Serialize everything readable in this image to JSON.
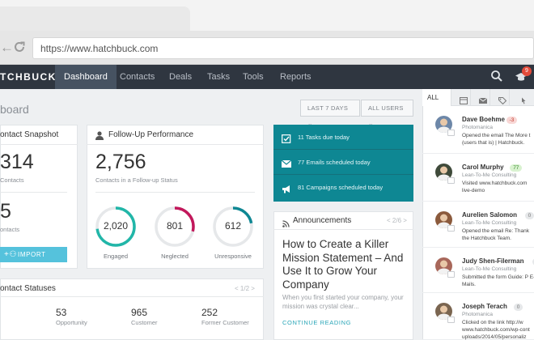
{
  "browser": {
    "url": "https://www.hatchbuck.com",
    "back_icon": "back-arrow-icon",
    "reload_icon": "reload-icon"
  },
  "app": {
    "logo": "TCHBUCK",
    "nav": [
      {
        "label": "Dashboard",
        "active": true
      },
      {
        "label": "Contacts",
        "active": false
      },
      {
        "label": "Deals",
        "active": false
      },
      {
        "label": "Tasks",
        "active": false
      },
      {
        "label": "Tools",
        "active": false
      },
      {
        "label": "Reports",
        "active": false
      }
    ],
    "notification_count": "9"
  },
  "page": {
    "title": "board",
    "filters": {
      "date": "LAST 7 DAYS ⌄",
      "users": "ALL USERS ⌄"
    }
  },
  "contact_snapshot": {
    "title": "ontact Snapshot",
    "total_value": "314",
    "total_label": "Contacts",
    "second_value": "5",
    "second_label": "ontacts",
    "import_label": "IMPORT"
  },
  "follow_up": {
    "title": "Follow-Up Performance",
    "total": "2,756",
    "subtitle": "Contacts in a Follow-up Status",
    "rings": [
      {
        "value": "2,020",
        "label": "Engaged",
        "color": "#21b6a8",
        "fraction": 0.73
      },
      {
        "value": "801",
        "label": "Neglected",
        "color": "#c2185b",
        "fraction": 0.29
      },
      {
        "value": "612",
        "label": "Unresponsive",
        "color": "#0e8793",
        "fraction": 0.22
      }
    ]
  },
  "teal_panel": {
    "rows": [
      {
        "icon": "checkbox-icon",
        "label": "11 Tasks due today"
      },
      {
        "icon": "envelope-icon",
        "label": "77 Emails scheduled today"
      },
      {
        "icon": "megaphone-icon",
        "label": "81 Campaigns scheduled today"
      }
    ]
  },
  "announcements": {
    "title": "Announcements",
    "pager": "< 2/6 >",
    "headline": "How to Create a Killer Mission Statement – And Use It to Grow Your Company",
    "blurb": "When you first started your company, your mission was crystal clear...",
    "link": "CONTINUE READING"
  },
  "contact_statuses": {
    "title": "ontact Statuses",
    "pager": "< 1/2 >",
    "stats": [
      {
        "value": "53",
        "label": "Opportunity"
      },
      {
        "value": "965",
        "label": "Customer"
      },
      {
        "value": "252",
        "label": "Former Customer"
      }
    ]
  },
  "activity": {
    "tab_all": "ALL",
    "tab_icons": [
      "card-icon",
      "envelope-icon",
      "tag-icon",
      "pointer-icon"
    ],
    "items": [
      {
        "name": "Dave Boehme",
        "score": "-3",
        "score_bg": "#f8d7d5",
        "score_fg": "#c0392b",
        "company": "Photomanica",
        "desc": "Opened the email The More t (users that is) | Hatchbuck.",
        "avatar_bg": "#6d87a8"
      },
      {
        "name": "Carol Murphy",
        "score": "77",
        "score_bg": "#d9f2d0",
        "score_fg": "#3c8d2f",
        "company": "Lean-To-Me Consulting",
        "desc": "Visited www.hatchbuck.com live-demo",
        "avatar_bg": "#3f4a3a"
      },
      {
        "name": "Aurelien Salomon",
        "score": "0",
        "score_bg": "#e6e8ea",
        "score_fg": "#777",
        "company": "Lean-To-Me Consulting",
        "desc": "Opened the email Re: Thank the Hatchbuck Team.",
        "avatar_bg": "#8b5a3c"
      },
      {
        "name": "Judy Shen-Filerman",
        "score": "0",
        "score_bg": "#e6e8ea",
        "score_fg": "#777",
        "company": "Lean-To-Me Consulting",
        "desc": "Submitted the form Guide: P E-Mails.",
        "avatar_bg": "#a8675a"
      },
      {
        "name": "Joseph Terach",
        "score": "0",
        "score_bg": "#e6e8ea",
        "score_fg": "#777",
        "company": "Photomanica",
        "desc": "Clicked on the link http://w www.hatchbuck.com/wp-cont uploads/2014/05/personaliz",
        "avatar_bg": "#7a6550"
      }
    ]
  }
}
